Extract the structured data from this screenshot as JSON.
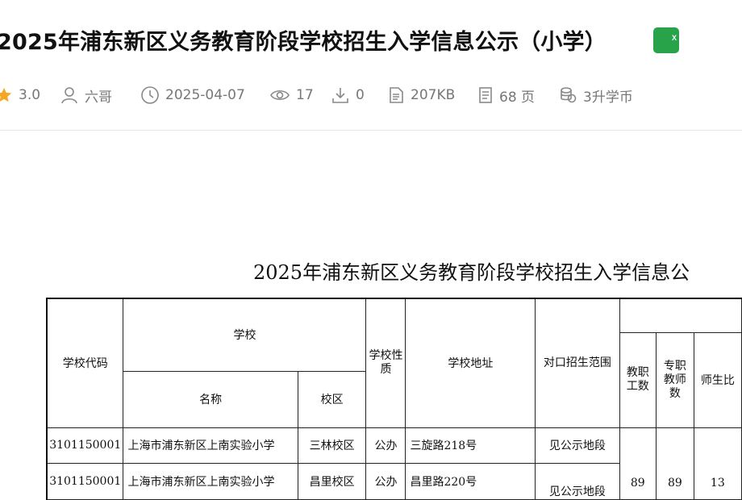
{
  "doc": {
    "title": "2025年浦东新区义务教育阶段学校招生入学信息公示（小学）",
    "file_icon_label": "X"
  },
  "meta": {
    "rating": "3.0",
    "author": "六哥",
    "date": "2025-04-07",
    "views": "17",
    "downloads": "0",
    "size": "207KB",
    "pages": "68 页",
    "price": "3升学币"
  },
  "sheet": {
    "title": "2025年浦东新区义务教育阶段学校招生入学信息公",
    "headers": {
      "code": "学校代码",
      "school": "学校",
      "name": "名称",
      "campus": "校区",
      "nature": "学校性质",
      "address": "学校地址",
      "range": "对口招生范围",
      "staff": "教职工数",
      "teachers": "专职教师数",
      "ratio": "师生比"
    },
    "rows": [
      {
        "code": "3101150001",
        "name": "上海市浦东新区上南实验小学",
        "campus": "三林校区",
        "nature": "公办",
        "address": "三旋路218号",
        "range": "见公示地段"
      },
      {
        "code": "3101150001",
        "name": "上海市浦东新区上南实验小学",
        "campus": "昌里校区",
        "nature": "公办",
        "address": "昌里路220号",
        "range": "见公示地段"
      }
    ],
    "merged": {
      "staff": "89",
      "teachers": "89",
      "ratio": "13"
    }
  },
  "colors": {
    "accent_star": "#f5a623",
    "excel_green": "#29a34a",
    "meta_gray": "#777777"
  }
}
